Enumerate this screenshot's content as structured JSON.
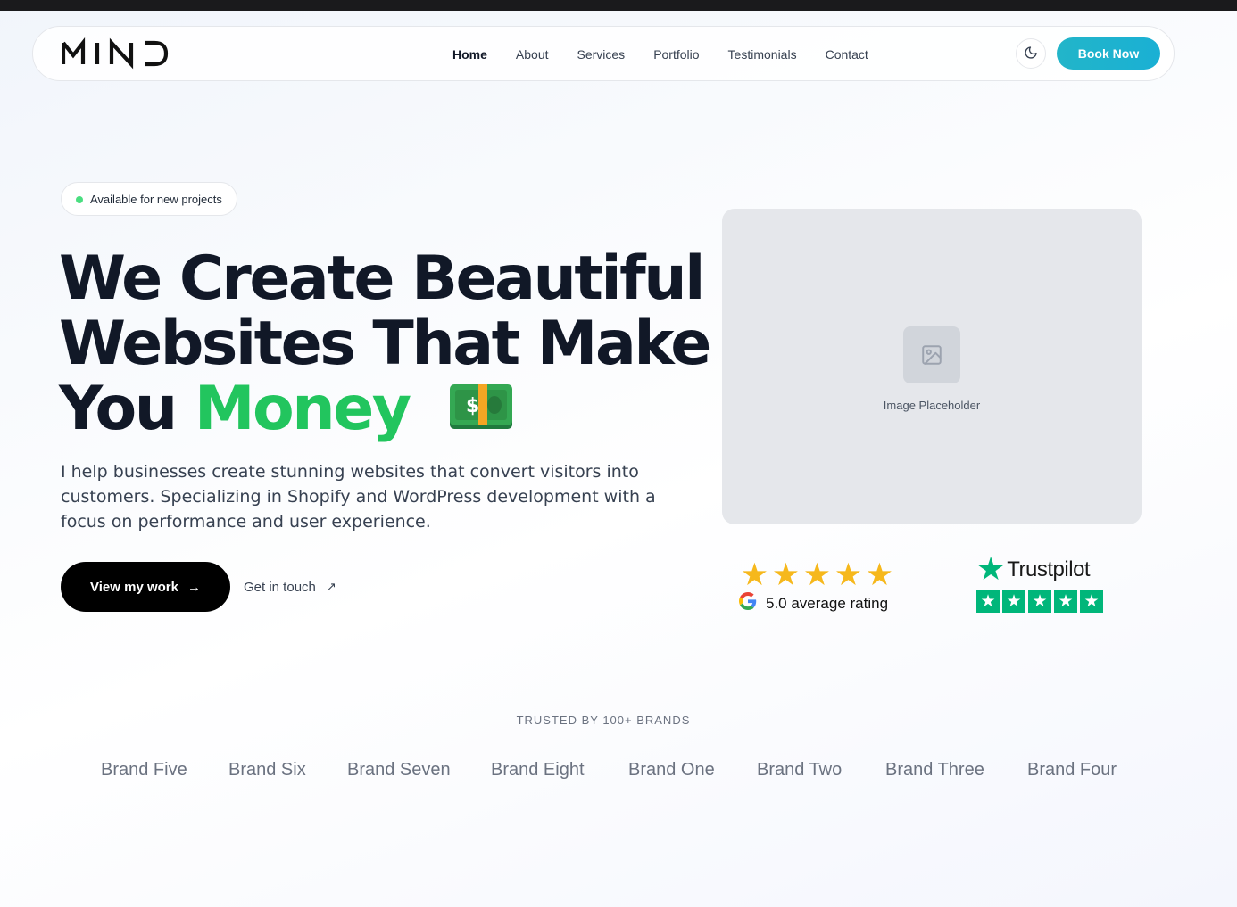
{
  "nav": {
    "logo_text": "MIND",
    "links": [
      "Home",
      "About",
      "Services",
      "Portfolio",
      "Testimonials",
      "Contact"
    ],
    "active": "Home",
    "theme_icon": "moon-icon",
    "book_label": "Book Now",
    "accent": "#1fb3cd"
  },
  "hero": {
    "badge": "Available for new projects",
    "headline": {
      "line1": "We Create Beautiful",
      "line2": "Websites That Make",
      "line3_prefix": "You",
      "line3_highlight": "Money"
    },
    "highlight_color": "#22c55e",
    "money_icon": "money-bill-emoji",
    "lead": "I help businesses create stunning websites that convert visitors into customers. Specializing in Shopify and WordPress development with a focus on performance and user experience.",
    "primary_cta": "View my work",
    "secondary_cta": "Get in touch"
  },
  "image_placeholder": {
    "label": "Image Placeholder",
    "icon": "image-icon"
  },
  "ratings": {
    "google": {
      "stars": 5,
      "text": "5.0 average rating",
      "icon": "google-g-icon"
    },
    "trustpilot": {
      "name": "Trustpilot",
      "stars": 5,
      "star_color": "#00b67a"
    }
  },
  "trusted": {
    "title": "TRUSTED BY 100+ BRANDS",
    "brands": [
      "Brand Five",
      "Brand Six",
      "Brand Seven",
      "Brand Eight",
      "Brand One",
      "Brand Two",
      "Brand Three",
      "Brand Four"
    ]
  }
}
